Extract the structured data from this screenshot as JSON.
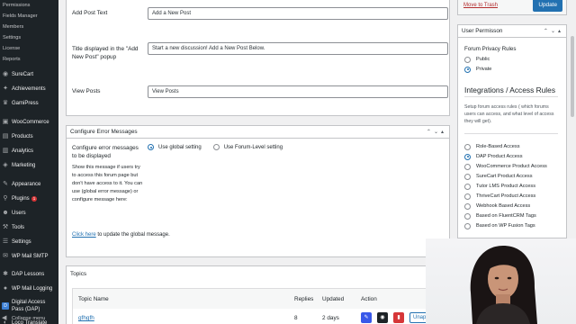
{
  "sidebar": {
    "sub_items": [
      "Permissions",
      "Fields Manager",
      "Members",
      "Settings",
      "License",
      "Reports"
    ],
    "items": [
      {
        "label": "SureCart",
        "icon": "surecart-icon"
      },
      {
        "label": "Achievements",
        "icon": "achievements-icon"
      },
      {
        "label": "GamiPress",
        "icon": "gamipress-icon"
      },
      {
        "label": "WooCommerce",
        "icon": "woocommerce-icon"
      },
      {
        "label": "Products",
        "icon": "products-icon"
      },
      {
        "label": "Analytics",
        "icon": "analytics-icon"
      },
      {
        "label": "Marketing",
        "icon": "marketing-icon"
      },
      {
        "label": "Appearance",
        "icon": "appearance-icon"
      },
      {
        "label": "Plugins",
        "icon": "plugins-icon",
        "badge": "1"
      },
      {
        "label": "Users",
        "icon": "users-icon"
      },
      {
        "label": "Tools",
        "icon": "tools-icon"
      },
      {
        "label": "Settings",
        "icon": "settings-icon"
      },
      {
        "label": "WP Mail SMTP",
        "icon": "mail-icon"
      },
      {
        "label": "DAP Lessons",
        "icon": "lessons-icon"
      },
      {
        "label": "WP Mail Logging",
        "icon": "mail-logging-icon"
      },
      {
        "label": "Digital Access Pass (DAP)",
        "icon": "dap-icon"
      },
      {
        "label": "Loco Translate",
        "icon": "translate-icon"
      }
    ],
    "collapse": "Collapse menu"
  },
  "form": {
    "add_post_text_label": "Add Post Text",
    "add_post_text_value": "Add a New Post",
    "title_label": "Title displayed in the \"Add New Post\" popup",
    "title_value": "Start a new discussion! Add a New Post Below.",
    "view_posts_label": "View Posts",
    "view_posts_value": "View Posts"
  },
  "error_messages": {
    "heading": "Configure Error Messages",
    "configure_label": "Configure error messages to be displayed",
    "option_global": "Use global setting",
    "option_forum": "Use Forum-Level setting",
    "help": "Show this message if users try to access this forum page but don't have access to it. You can use (global error message) or configure message here:",
    "click_here": "Click here",
    "click_rest": "to update the global message."
  },
  "topics": {
    "heading": "Topics",
    "columns": [
      "Topic Name",
      "Replies",
      "Updated",
      "Action"
    ],
    "rows": [
      {
        "name": "gfhgfh",
        "replies": "8",
        "updated": "2 days",
        "unapprove": "Unap"
      }
    ]
  },
  "right": {
    "trash": "Move to Trash",
    "update": "Update",
    "user_permission": "User Permisson",
    "forum_privacy": "Forum Privacy Rules",
    "privacy_options": [
      "Public",
      "Private"
    ],
    "privacy_selected": "Private",
    "integrations_title": "Integrations / Access Rules",
    "integrations_desc": "Setup forum access rules ( which forums users can access, and what level of access they will get).",
    "access_options": [
      "Role-Based Access",
      "DAP Product Access",
      "WooCommerce Product Access",
      "SureCart Product Access",
      "Tutor LMS Product Access",
      "ThriveCart Product Access",
      "Webhook Based Access",
      "Based on FluentCRM Tags",
      "Based on WP Fusion Tags"
    ],
    "access_selected": "DAP Product Access"
  },
  "colors": {
    "sidebar_bg": "#1d2327",
    "accent": "#2271b1",
    "trash": "#b32d2e",
    "edit_btn": "#3858e9",
    "delete_btn": "#d63638"
  }
}
